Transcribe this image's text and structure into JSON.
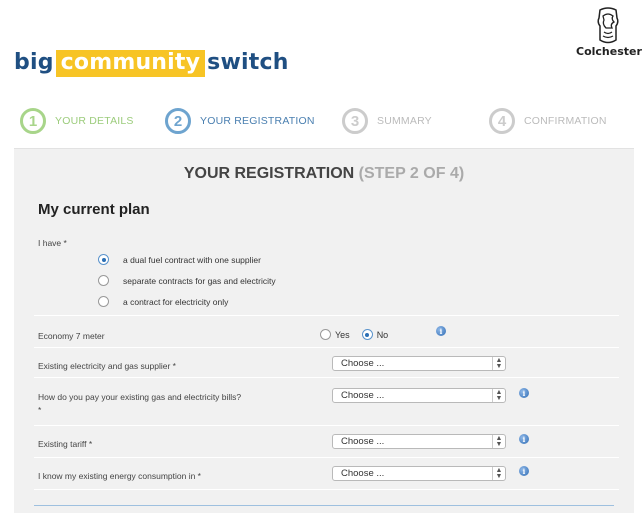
{
  "header": {
    "logo_part1": "big",
    "logo_part2": "community",
    "logo_part3": "switch",
    "partner_name": "Colchester"
  },
  "steps": [
    {
      "number": "1",
      "label": "YOUR DETAILS",
      "state": "done"
    },
    {
      "number": "2",
      "label": "YOUR REGISTRATION",
      "state": "active"
    },
    {
      "number": "3",
      "label": "SUMMARY",
      "state": "pending"
    },
    {
      "number": "4",
      "label": "CONFIRMATION",
      "state": "pending"
    }
  ],
  "panel": {
    "title": "YOUR REGISTRATION",
    "title_step": "(STEP 2 OF 4)",
    "section_title": "My current plan"
  },
  "form": {
    "i_have": {
      "label": "I have *",
      "options": [
        {
          "label": "a dual fuel contract with one supplier",
          "selected": true
        },
        {
          "label": "separate contracts for gas and electricity",
          "selected": false
        },
        {
          "label": "a contract for electricity only",
          "selected": false
        }
      ]
    },
    "economy7": {
      "label": "Economy 7 meter",
      "yes_label": "Yes",
      "no_label": "No",
      "selected": "No"
    },
    "supplier": {
      "label": "Existing electricity and gas supplier *",
      "value": "Choose ..."
    },
    "payment": {
      "label_line1": "How do you pay your existing gas and electricity bills?",
      "label_line2": "*",
      "value": "Choose ..."
    },
    "tariff": {
      "label": "Existing tariff *",
      "value": "Choose ..."
    },
    "consumption": {
      "label": "I know my existing energy consumption in *",
      "value": "Choose ..."
    }
  },
  "colors": {
    "brand_blue": "#1f4f82",
    "brand_yellow": "#f7c425",
    "step_done": "#a8d58a",
    "step_active": "#6ea4cf",
    "step_pending": "#cccccc",
    "panel_bg": "#f1f1f1",
    "info_icon": "#2f6cb4"
  },
  "icons": [
    "radio-selected",
    "radio-unselected",
    "info-icon",
    "select-arrows-icon",
    "colchester-crest"
  ]
}
